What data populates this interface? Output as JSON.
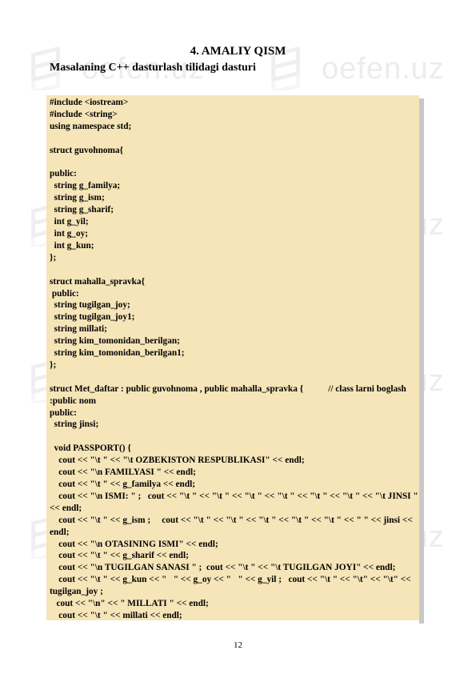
{
  "watermark": {
    "text": "oefen.uz"
  },
  "heading": "4. AMALIY QISM",
  "subheading": "Masalaning C++ dasturlash tilidagi dasturi",
  "code_lines": [
    "#include <iostream>",
    "#include <string>",
    "using namespace std;",
    "",
    "struct guvohnoma{",
    "",
    "public:",
    "  string g_familya;",
    "  string g_ism;",
    "  string g_sharif;",
    "  int g_yil;",
    "  int g_oy;",
    "  int g_kun;",
    "};",
    "",
    "struct mahalla_spravka{",
    " public:",
    "  string tugilgan_joy;",
    "  string tugilgan_joy1;",
    "  string millati;",
    "  string kim_tomonidan_berilgan;",
    "  string kim_tomonidan_berilgan1;",
    "};",
    "",
    "struct Met_daftar : public guvohnoma , public mahalla_spravka {           // class larni boglash    :public nom",
    "public:",
    "  string jinsi;",
    "",
    "  void PASSPORT() {",
    "    cout << \"\\t \" << \"\\t OZBEKISTON RESPUBLIKASI\" << endl;",
    "    cout << \"\\n FAMILYASI \" << endl;",
    "    cout << \"\\t \" << g_familya << endl;",
    "    cout << \"\\n ISMI: \" ;   cout << \"\\t \" << \"\\t \" << \"\\t \" << \"\\t \" << \"\\t \" << \"\\t \" << \"\\t JINSI \" << endl;",
    "    cout << \"\\t \" << g_ism ;     cout << \"\\t \" << \"\\t \" << \"\\t \" << \"\\t \" << \"\\t \" << \" \" << jinsi << endl;",
    "    cout << \"\\n OTASINING ISMI\" << endl;",
    "    cout << \"\\t \" << g_sharif << endl;",
    "    cout << \"\\n TUGILGAN SANASI \" ;  cout << \"\\t \" << \"\\t TUGILGAN JOYI\" << endl;",
    "    cout << \"\\t \" << g_kun << \"   \" << g_oy << \"   \" << g_yil ;   cout << \"\\t \" << \"\\t\" << \"\\t\" << tugilgan_joy ;",
    "   cout << \"\\n\" << \" MILLATI \" << endl;",
    "    cout << \"\\t \" << millati << endl;"
  ],
  "page_number": "12"
}
